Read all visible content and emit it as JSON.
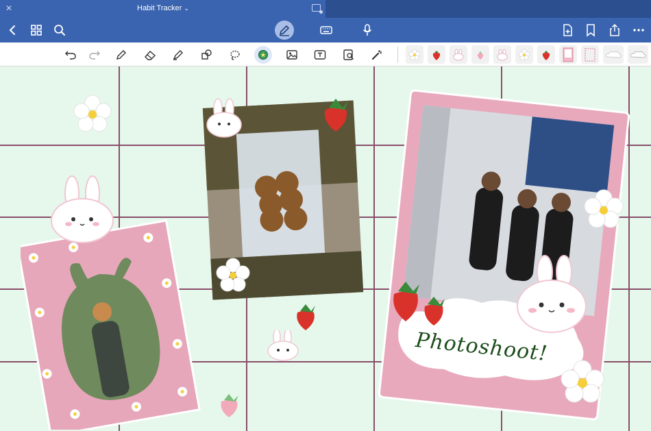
{
  "window": {
    "title": "Habit Tracker"
  },
  "navbar": {
    "left": [
      "back-icon",
      "grid-icon",
      "search-icon"
    ],
    "center": [
      "pen-mode-icon",
      "keyboard-icon",
      "microphone-icon"
    ],
    "right": [
      "add-page-icon",
      "bookmark-icon",
      "share-icon",
      "more-icon"
    ]
  },
  "toolbar": {
    "tools": [
      "undo-icon",
      "redo-icon",
      "pen-icon",
      "eraser-icon",
      "highlighter-icon",
      "shapes-icon",
      "lasso-icon",
      "sticker-icon",
      "image-icon",
      "textbox-icon",
      "scan-icon",
      "laser-icon"
    ],
    "active_tool": "sticker-icon"
  },
  "canvas": {
    "background": "#e6f8ec",
    "grid_color": "#8a4d69",
    "frame_pink": "#e8a9bd",
    "polaroid_caption": "Photoshoot!"
  }
}
